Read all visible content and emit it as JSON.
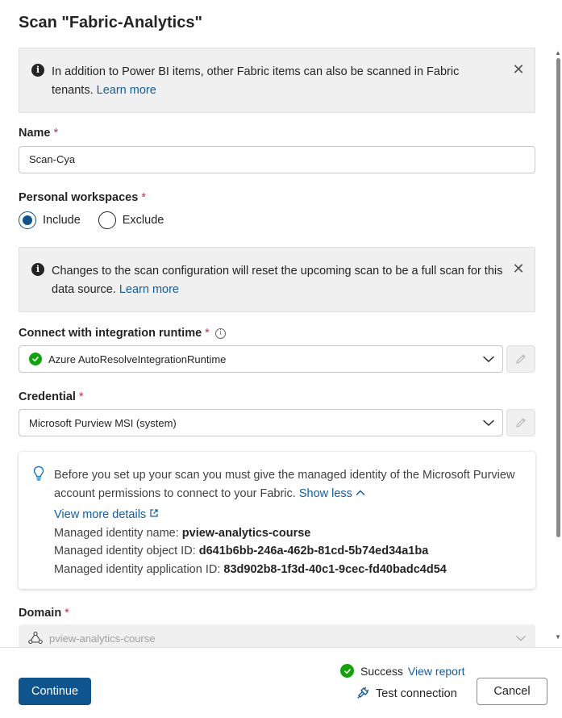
{
  "panel": {
    "title": "Scan \"Fabric-Analytics\""
  },
  "banner_fabric": {
    "text": "In addition to Power BI items, other Fabric items can also be scanned in Fabric tenants.",
    "link": "Learn more"
  },
  "name_field": {
    "label": "Name",
    "required_mark": "*",
    "value": "Scan-Cya"
  },
  "personal_workspaces": {
    "label": "Personal workspaces",
    "required_mark": "*",
    "options": [
      {
        "label": "Include",
        "selected": true
      },
      {
        "label": "Exclude",
        "selected": false
      }
    ]
  },
  "banner_reset": {
    "text": "Changes to the scan configuration will reset the upcoming scan to be a full scan for this data source.",
    "link": "Learn more"
  },
  "integration_runtime": {
    "label": "Connect with integration runtime",
    "required_mark": "*",
    "value": "Azure AutoResolveIntegrationRuntime",
    "status_icon": "success-check-icon"
  },
  "credential": {
    "label": "Credential",
    "required_mark": "*",
    "value": "Microsoft Purview MSI (system)"
  },
  "info_card": {
    "text": "Before you set up your scan you must give the managed identity of the Microsoft Purview account permissions to connect to your Fabric.",
    "show_less": "Show less",
    "view_more": "View more details",
    "rows": [
      {
        "label": "Managed identity name:",
        "value": "pview-analytics-course"
      },
      {
        "label": "Managed identity object ID:",
        "value": "d641b6bb-246a-462b-81cd-5b74ed34a1ba"
      },
      {
        "label": "Managed identity application ID:",
        "value": "83d902b8-1f3d-40c1-9cec-fd40badc4d54"
      }
    ]
  },
  "domain": {
    "label": "Domain",
    "required_mark": "*",
    "value": "pview-analytics-course"
  },
  "footer": {
    "continue": "Continue",
    "cancel": "Cancel",
    "status_text": "Success",
    "view_report": "View report",
    "test_connection": "Test connection"
  },
  "colors": {
    "primary": "#0f548c",
    "link": "#115ea3",
    "required": "#c4314b",
    "success": "#13a10e",
    "banner_bg": "#f0f0f0"
  }
}
